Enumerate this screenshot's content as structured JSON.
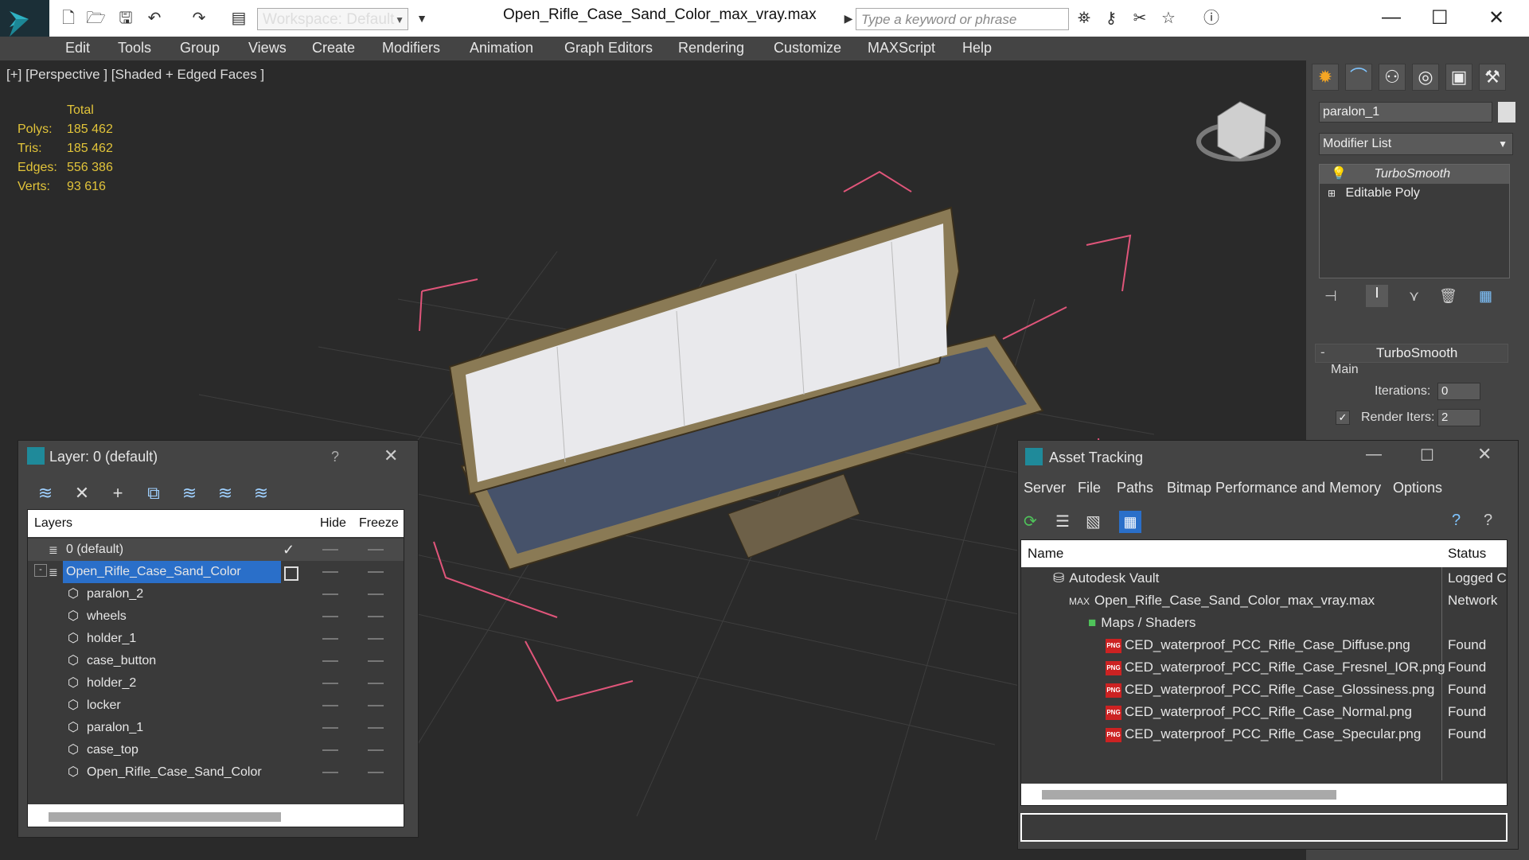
{
  "titlebar": {
    "workspace": "Workspace: Default",
    "document_title": "Open_Rifle_Case_Sand_Color_max_vray.max",
    "search_placeholder": "Type a keyword or phrase"
  },
  "menubar": [
    "Edit",
    "Tools",
    "Group",
    "Views",
    "Create",
    "Modifiers",
    "Animation",
    "Graph Editors",
    "Rendering",
    "Customize",
    "MAXScript",
    "Help"
  ],
  "viewport": {
    "label": "[+] [Perspective ] [Shaded + Edged Faces ]",
    "stats_header": "Total",
    "stats": [
      {
        "label": "Polys:",
        "value": "185 462"
      },
      {
        "label": "Tris:",
        "value": "185 462"
      },
      {
        "label": "Edges:",
        "value": "556 386"
      },
      {
        "label": "Verts:",
        "value": "93 616"
      }
    ]
  },
  "command_panel": {
    "object_name": "paralon_1",
    "modifier_list": "Modifier List",
    "stack": [
      "TurboSmooth",
      "Editable Poly"
    ],
    "rollout_title": "TurboSmooth",
    "group_main": "Main",
    "iterations_label": "Iterations:",
    "iterations_value": "0",
    "render_iters_label": "Render Iters:",
    "render_iters_value": "2"
  },
  "layer_dialog": {
    "title": "Layer: 0 (default)",
    "help": "?",
    "col_layers": "Layers",
    "col_hide": "Hide",
    "col_freeze": "Freeze",
    "rows": [
      {
        "name": "0 (default)"
      },
      {
        "name": "Open_Rifle_Case_Sand_Color"
      },
      {
        "name": "paralon_2"
      },
      {
        "name": "wheels"
      },
      {
        "name": "holder_1"
      },
      {
        "name": "case_button"
      },
      {
        "name": "holder_2"
      },
      {
        "name": "locker"
      },
      {
        "name": "paralon_1"
      },
      {
        "name": "case_top"
      },
      {
        "name": "Open_Rifle_Case_Sand_Color"
      }
    ]
  },
  "asset_dialog": {
    "title": "Asset Tracking",
    "menu": [
      "Server",
      "File",
      "Paths",
      "Bitmap Performance and Memory",
      "Options"
    ],
    "col_name": "Name",
    "col_status": "Status",
    "rows": [
      {
        "name": "Autodesk Vault",
        "status": "Logged C"
      },
      {
        "name": "Open_Rifle_Case_Sand_Color_max_vray.max",
        "status": "Network"
      },
      {
        "name": "Maps / Shaders",
        "status": ""
      },
      {
        "name": "CED_waterproof_PCC_Rifle_Case_Diffuse.png",
        "status": "Found"
      },
      {
        "name": "CED_waterproof_PCC_Rifle_Case_Fresnel_IOR.png",
        "status": "Found"
      },
      {
        "name": "CED_waterproof_PCC_Rifle_Case_Glossiness.png",
        "status": "Found"
      },
      {
        "name": "CED_waterproof_PCC_Rifle_Case_Normal.png",
        "status": "Found"
      },
      {
        "name": "CED_waterproof_PCC_Rifle_Case_Specular.png",
        "status": "Found"
      }
    ]
  },
  "colors": {
    "accent": "#1f78d1",
    "stats": "#e2c43a",
    "selection": "#2a6fc9"
  }
}
